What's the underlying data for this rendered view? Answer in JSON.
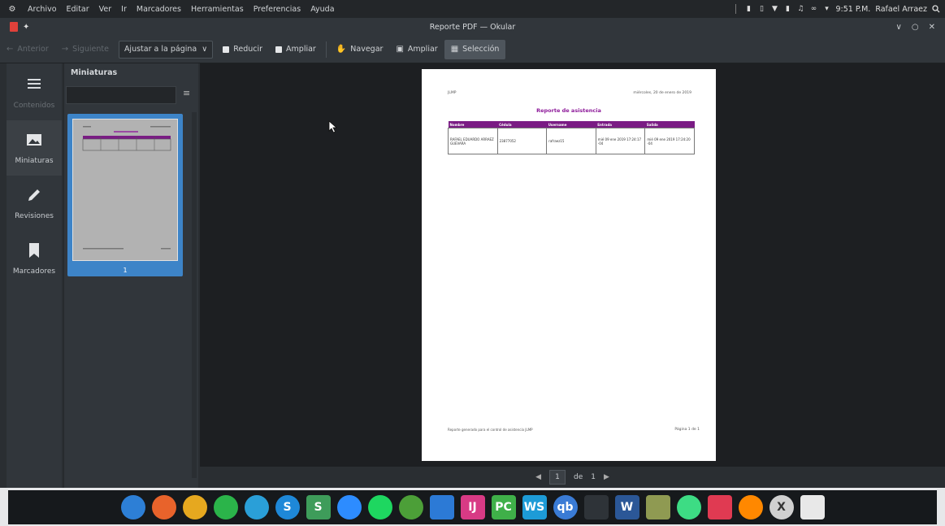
{
  "menubar": {
    "menus": [
      "Archivo",
      "Editar",
      "Ver",
      "Ir",
      "Marcadores",
      "Herramientas",
      "Preferencias",
      "Ayuda"
    ],
    "clock": "9:51 P.M.",
    "user": "Rafael Arraez"
  },
  "window": {
    "title": "Reporte PDF — Okular"
  },
  "toolbar": {
    "previous": "Anterior",
    "next": "Siguiente",
    "zoom_mode": "Ajustar a la página",
    "zoom_out": "Reducir",
    "zoom_in": "Ampliar",
    "browse": "Navegar",
    "magnify": "Ampliar",
    "selection": "Selección"
  },
  "sidebar": {
    "items": [
      {
        "label": "Contenidos",
        "icon": "list-icon"
      },
      {
        "label": "Miniaturas",
        "icon": "image-icon"
      },
      {
        "label": "Revisiones",
        "icon": "pencil-icon"
      },
      {
        "label": "Marcadores",
        "icon": "bookmark-icon"
      }
    ]
  },
  "thumbnails": {
    "title": "Miniaturas",
    "filter_placeholder": "",
    "page_number": "1"
  },
  "document": {
    "header_left": "JLMP",
    "header_right": "miércoles, 20 de enero de 2019",
    "report_title": "Reporte de asistencia",
    "columns": [
      "Nombre",
      "Cédula",
      "Username",
      "Entrada",
      "Salida"
    ],
    "rows": [
      [
        "RAFAEL EDUARDO ARRAEZ GUEVARA",
        "23877052",
        "rafraez15",
        "mié 09 ene 2019 17:24:17 -04",
        "mié 09 ene 2019 17:24:20 -04"
      ]
    ],
    "footer_left": "Reporte generado para el control de asistencia JLMP",
    "footer_right": "Página 1 de 1"
  },
  "navigation": {
    "current_page": "1",
    "of_label": "de",
    "total_pages": "1"
  },
  "dock": {
    "apps": [
      {
        "name": "plasma-icon",
        "color": "#2d7fd6",
        "glyph": ""
      },
      {
        "name": "firefox-icon",
        "color": "#e8632b",
        "glyph": ""
      },
      {
        "name": "chrome-icon",
        "color": "#e6a81f",
        "glyph": ""
      },
      {
        "name": "whatsapp-icon",
        "color": "#2bb44a",
        "glyph": ""
      },
      {
        "name": "telegram-icon",
        "color": "#2a9fd8",
        "glyph": ""
      },
      {
        "name": "skype-icon",
        "color": "#1e88d8",
        "glyph": "S"
      },
      {
        "name": "slack-icon",
        "color": "#3e9c5a",
        "glyph": "S"
      },
      {
        "name": "zoom-icon",
        "color": "#2d8cff",
        "glyph": ""
      },
      {
        "name": "spotify-icon",
        "color": "#1ed760",
        "glyph": ""
      },
      {
        "name": "mongodb-icon",
        "color": "#4c9f38",
        "glyph": ""
      },
      {
        "name": "vscode-icon",
        "color": "#2c7ad6",
        "glyph": ""
      },
      {
        "name": "intellij-icon",
        "color": "#d83a85",
        "glyph": "IJ"
      },
      {
        "name": "pycharm-icon",
        "color": "#3fb049",
        "glyph": "PC"
      },
      {
        "name": "webstorm-icon",
        "color": "#1d9bd7",
        "glyph": "WS"
      },
      {
        "name": "qbittorrent-icon",
        "color": "#3a7bd5",
        "glyph": "qb"
      },
      {
        "name": "terminal-icon",
        "color": "#2e3338",
        "glyph": ""
      },
      {
        "name": "word-icon",
        "color": "#2b5797",
        "glyph": "W"
      },
      {
        "name": "notes-icon",
        "color": "#8f9a52",
        "glyph": ""
      },
      {
        "name": "android-icon",
        "color": "#3ddc84",
        "glyph": ""
      },
      {
        "name": "screenshot-icon",
        "color": "#e03a52",
        "glyph": ""
      },
      {
        "name": "vlc-icon",
        "color": "#ff8800",
        "glyph": ""
      },
      {
        "name": "xserver-icon",
        "color": "#d0d0d0",
        "glyph": "X"
      },
      {
        "name": "okular-icon",
        "color": "#e8e8e8",
        "glyph": ""
      }
    ]
  }
}
